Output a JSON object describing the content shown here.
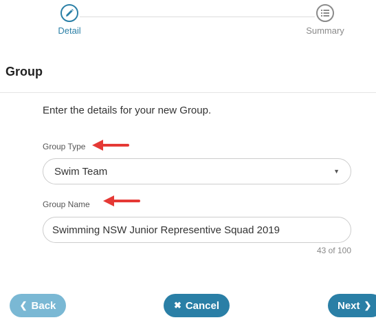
{
  "wizard": {
    "steps": [
      {
        "label": "Detail",
        "icon": "pencil-icon",
        "state": "active"
      },
      {
        "label": "Summary",
        "icon": "list-icon",
        "state": "inactive"
      }
    ]
  },
  "section": {
    "title": "Group"
  },
  "form": {
    "intro": "Enter the details for your new Group.",
    "group_type": {
      "label": "Group Type",
      "value": "Swim Team"
    },
    "group_name": {
      "label": "Group Name",
      "value": "Swimming NSW Junior Representive Squad 2019",
      "counter": "43 of 100"
    }
  },
  "buttons": {
    "back": {
      "label": "Back",
      "icon": "chevron-left-icon"
    },
    "cancel": {
      "label": "Cancel",
      "icon": "times-icon"
    },
    "next": {
      "label": "Next",
      "icon": "chevron-right-icon"
    }
  },
  "colors": {
    "primary": "#2a7fa6",
    "disabled": "#7ab8d4",
    "annotation": "#e53935",
    "inactive": "#8a8a8a"
  }
}
